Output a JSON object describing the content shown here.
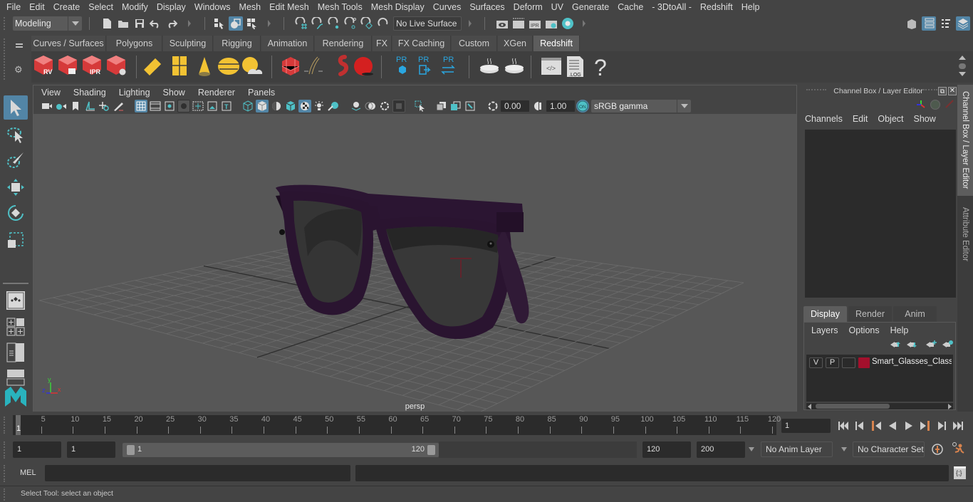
{
  "menubar": [
    "File",
    "Edit",
    "Create",
    "Select",
    "Modify",
    "Display",
    "Windows",
    "Mesh",
    "Edit Mesh",
    "Mesh Tools",
    "Mesh Display",
    "Curves",
    "Surfaces",
    "Deform",
    "UV",
    "Generate",
    "Cache",
    "- 3DtoAll -",
    "Redshift",
    "Help"
  ],
  "statusline": {
    "mode": "Modeling",
    "live_surface": "No Live Surface",
    "icons": [
      "new-scene-icon",
      "open-scene-icon",
      "save-scene-icon",
      "undo-icon",
      "redo-icon",
      "select-by-hierarchy-icon",
      "select-by-object-icon",
      "select-by-component-icon",
      "snap-grid-icon",
      "snap-curve-icon",
      "snap-point-icon",
      "snap-view-plane-icon",
      "snap-live-icon",
      "make-live-icon",
      "render-view-icon",
      "render-current-frame-icon",
      "ipr-render-icon",
      "render-settings-icon",
      "hypershade-icon"
    ],
    "right_icons": [
      "modeling-toolkit-icon",
      "attribute-editor-toggle-icon",
      "tool-settings-toggle-icon",
      "channel-box-toggle-icon"
    ]
  },
  "shelf": {
    "tabs": [
      "Curves / Surfaces",
      "Polygons",
      "Sculpting",
      "Rigging",
      "Animation",
      "Rendering",
      "FX",
      "FX Caching",
      "Custom",
      "XGen",
      "Redshift"
    ],
    "active_tab": "Redshift",
    "buttons": [
      {
        "name": "redshift-render-view-icon",
        "label": "RV"
      },
      {
        "name": "redshift-batch-render-icon",
        "label": ""
      },
      {
        "name": "redshift-ipr-icon",
        "label": "IPR"
      },
      {
        "name": "redshift-render-settings-icon",
        "label": ""
      },
      {
        "name": "redshift-area-light-icon",
        "label": ""
      },
      {
        "name": "redshift-portal-light-icon",
        "label": ""
      },
      {
        "name": "redshift-spot-light-icon",
        "label": ""
      },
      {
        "name": "redshift-dome-light-icon",
        "label": ""
      },
      {
        "name": "redshift-sun-sky-icon",
        "label": ""
      },
      {
        "name": "redshift-proxy-icon",
        "label": ""
      },
      {
        "name": "redshift-hair-icon",
        "label": ""
      },
      {
        "name": "redshift-volume-icon",
        "label": ""
      },
      {
        "name": "redshift-sphere-icon",
        "label": ""
      },
      {
        "name": "redshift-pr-export-icon",
        "label": "PR"
      },
      {
        "name": "redshift-pr-import-icon",
        "label": "PR"
      },
      {
        "name": "redshift-pr-swap-icon",
        "label": "PR"
      },
      {
        "name": "redshift-bake-icon",
        "label": ""
      },
      {
        "name": "redshift-bake-set-icon",
        "label": ""
      },
      {
        "name": "redshift-script-icon",
        "label": ""
      },
      {
        "name": "redshift-log-icon",
        "label": ".LOG"
      },
      {
        "name": "help-icon",
        "label": "?"
      }
    ]
  },
  "viewport": {
    "menu": [
      "View",
      "Shading",
      "Lighting",
      "Show",
      "Renderer",
      "Panels"
    ],
    "exposure": "0.00",
    "gamma": "1.00",
    "color_management": "ON",
    "view_transform": "sRGB gamma",
    "camera_label": "persp",
    "axis": {
      "x": "x",
      "y": "y",
      "z": "z"
    }
  },
  "channel_box": {
    "title": "Channel Box / Layer Editor",
    "menu": [
      "Channels",
      "Edit",
      "Object",
      "Show"
    ],
    "layer_tabs": [
      "Display",
      "Render",
      "Anim"
    ],
    "active_layer_tab": "Display",
    "layer_menu": [
      "Layers",
      "Options",
      "Help"
    ],
    "layers": [
      {
        "visible": "V",
        "playback": "P",
        "name": "Smart_Glasses_Classic_",
        "color": "#a3102c"
      }
    ]
  },
  "side_tabs": [
    "Channel Box / Layer Editor",
    "Attribute Editor"
  ],
  "timeline": {
    "ticks": [
      5,
      10,
      15,
      20,
      25,
      30,
      35,
      40,
      45,
      50,
      55,
      60,
      65,
      70,
      75,
      80,
      85,
      90,
      95,
      100,
      105,
      110,
      115,
      120
    ],
    "current_frame_marker": "1",
    "current_frame": "1",
    "range_min": 1,
    "range_max": 120
  },
  "range": {
    "start_time": "1",
    "playback_start": "1",
    "range_start_label": "1",
    "range_end_label": "120",
    "playback_end": "120",
    "end_time": "200",
    "anim_layer": "No Anim Layer",
    "character_set": "No Character Set"
  },
  "command_line": {
    "label": "MEL",
    "input": "",
    "output": ""
  },
  "help_line": "Select Tool: select an object",
  "colors": {
    "accent": "#5285a6",
    "bg": "#444444",
    "field": "#2b2b2b",
    "frame_marker": "#d7834e",
    "glasses": "#2a1430"
  }
}
